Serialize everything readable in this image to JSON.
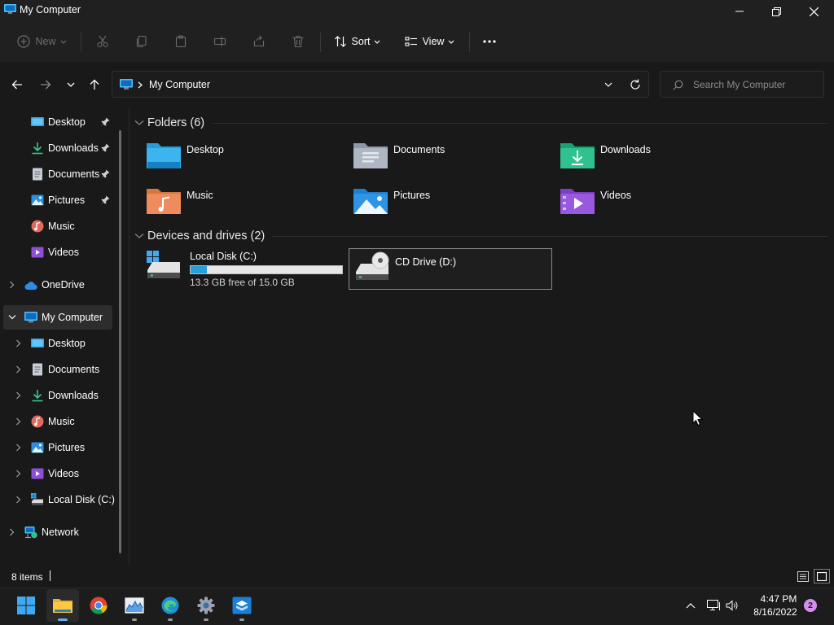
{
  "window": {
    "title": "My Computer"
  },
  "toolbar": {
    "new_label": "New",
    "sort_label": "Sort",
    "view_label": "View"
  },
  "address": {
    "location": "My Computer",
    "search_placeholder": "Search My Computer"
  },
  "sidebar": {
    "quick_access": [
      {
        "label": "Desktop",
        "icon": "desktop-icon",
        "pinned": true
      },
      {
        "label": "Downloads",
        "icon": "downloads-icon",
        "pinned": true
      },
      {
        "label": "Documents",
        "icon": "documents-icon",
        "pinned": true
      },
      {
        "label": "Pictures",
        "icon": "pictures-icon",
        "pinned": true
      },
      {
        "label": "Music",
        "icon": "music-icon",
        "pinned": false
      },
      {
        "label": "Videos",
        "icon": "videos-icon",
        "pinned": false
      }
    ],
    "onedrive": "OneDrive",
    "my_computer": "My Computer",
    "my_computer_children": [
      {
        "label": "Desktop",
        "icon": "desktop-icon"
      },
      {
        "label": "Documents",
        "icon": "documents-icon"
      },
      {
        "label": "Downloads",
        "icon": "downloads-icon"
      },
      {
        "label": "Music",
        "icon": "music-icon"
      },
      {
        "label": "Pictures",
        "icon": "pictures-icon"
      },
      {
        "label": "Videos",
        "icon": "videos-icon"
      },
      {
        "label": "Local Disk (C:)",
        "icon": "local-disk-icon"
      }
    ],
    "network": "Network"
  },
  "content": {
    "folders_heading": "Folders (6)",
    "folders": [
      {
        "label": "Desktop",
        "icon": "desktop-folder-icon"
      },
      {
        "label": "Documents",
        "icon": "documents-folder-icon"
      },
      {
        "label": "Downloads",
        "icon": "downloads-folder-icon"
      },
      {
        "label": "Music",
        "icon": "music-folder-icon"
      },
      {
        "label": "Pictures",
        "icon": "pictures-folder-icon"
      },
      {
        "label": "Videos",
        "icon": "videos-folder-icon"
      }
    ],
    "devices_heading": "Devices and drives (2)",
    "drives": [
      {
        "name": "Local Disk (C:)",
        "free_text": "13.3 GB free of 15.0 GB",
        "used_fraction": 0.11
      },
      {
        "name": "CD Drive (D:)"
      }
    ]
  },
  "status": {
    "item_count": "8 items"
  },
  "taskbar": {
    "apps": [
      "start-icon",
      "file-explorer-icon",
      "chrome-icon",
      "task-manager-icon",
      "edge-icon",
      "settings-icon",
      "sandbox-icon"
    ],
    "time": "4:47 PM",
    "date": "8/16/2022",
    "notification_count": "2"
  },
  "colors": {
    "accent": "#26a0da",
    "background": "#191919",
    "chrome": "#202020"
  }
}
